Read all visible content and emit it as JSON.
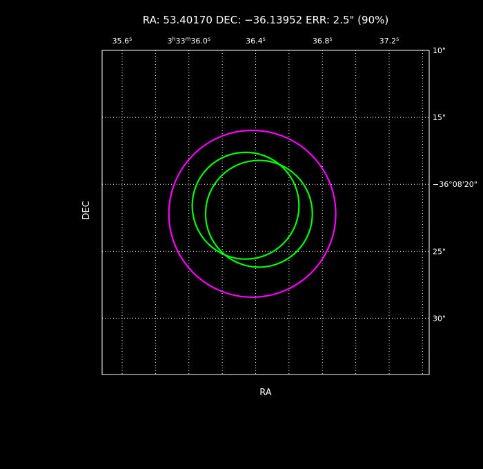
{
  "chart_data": {
    "type": "scatter",
    "title": "RA: 53.40170   DEC: −36.13952   ERR: 2.5\" (90%)",
    "xlabel": "RA",
    "ylabel": "DEC",
    "x_axis": {
      "unit": "arcsec",
      "range": [
        -5.2,
        4.6
      ],
      "reversed": true,
      "ticks": [
        {
          "value": -4,
          "label": "37.2s"
        },
        {
          "value": -2,
          "label": "36.8s"
        },
        {
          "value": 0,
          "label": "36.4s"
        },
        {
          "value": 2,
          "label": "3h33m36.0s"
        },
        {
          "value": 4,
          "label": "35.6s"
        }
      ]
    },
    "y_axis": {
      "unit": "arcsec",
      "range": [
        -14.2,
        10.0
      ],
      "ticks": [
        {
          "value": 10,
          "label": "10\""
        },
        {
          "value": 5,
          "label": "15\""
        },
        {
          "value": 0,
          "label": "−36°08'20\""
        },
        {
          "value": -5,
          "label": "25\""
        },
        {
          "value": -10,
          "label": "30\""
        }
      ]
    },
    "grid": true,
    "circles": [
      {
        "name": "",
        "x": 0.1,
        "y": -2.2,
        "r": 2.5,
        "color": "#ff00ff"
      },
      {
        "name": "",
        "x": 0.3,
        "y": -1.6,
        "r": 1.6,
        "color": "#00ff00"
      },
      {
        "name": "",
        "x": -0.1,
        "y": -2.2,
        "r": 1.6,
        "color": "#00ff00"
      }
    ]
  }
}
